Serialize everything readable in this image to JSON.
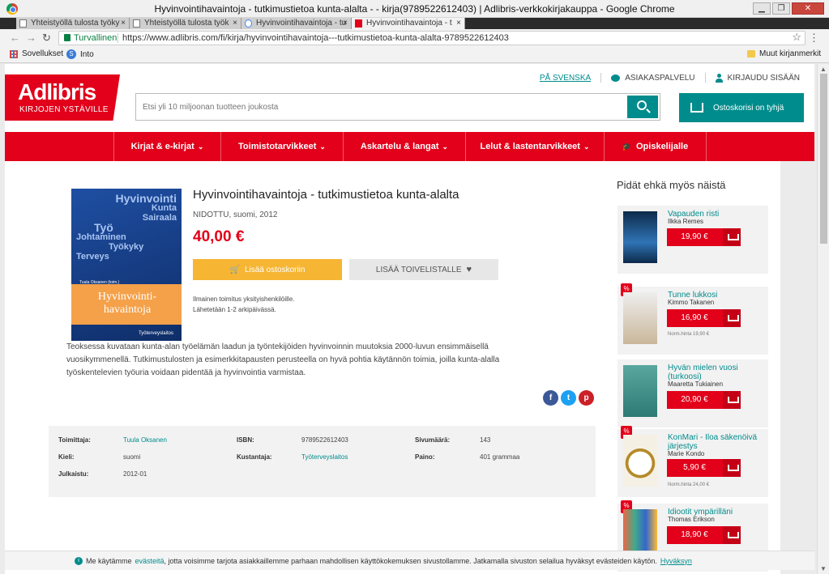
{
  "window": {
    "title": "Hyvinvointihavaintoja - tutkimustietoa kunta-alalta - - kirja(9789522612403) | Adlibris-verkkokirjakauppa - Google Chrome",
    "tabs": [
      {
        "label": "Yhteistyöllä tulosta työky"
      },
      {
        "label": "Yhteistyöllä tulosta työk"
      },
      {
        "label": "Hyvinvointihavaintoja - tu"
      },
      {
        "label": "Hyvinvointihavaintoja - t"
      }
    ]
  },
  "browser": {
    "secure_label": "Turvallinen",
    "url": "https://www.adlibris.com/fi/kirja/hyvinvointihavaintoja---tutkimustietoa-kunta-alalta-9789522612403",
    "bookmarks": {
      "apps": "Sovellukset",
      "into": "Into",
      "other": "Muut kirjanmerkit"
    }
  },
  "header": {
    "brand": "Adlibris",
    "tagline": "KIRJOJEN YSTÄVILLE",
    "lang_link": "PÅ SVENSKA",
    "customer_service": "ASIAKASPALVELU",
    "login": "KIRJAUDU SISÄÄN",
    "search_placeholder": "Etsi yli 10 miljoonan tuotteen joukosta",
    "cart_label": "Ostoskorisi on tyhjä"
  },
  "nav": [
    {
      "label": "Kirjat & e-kirjat"
    },
    {
      "label": "Toimistotarvikkeet"
    },
    {
      "label": "Askartelu & langat"
    },
    {
      "label": "Lelut & lastentarvikkeet"
    },
    {
      "label": "Opiskelijalle"
    }
  ],
  "product": {
    "title": "Hyvinvointihavaintoja - tutkimustietoa kunta-alalta",
    "meta": "NIDOTTU, suomi, 2012",
    "price": "40,00 €",
    "add_to_cart": "Lisää ostoskoriin",
    "wishlist": "LISÄÄ TOIVELISTALLE",
    "delivery_1": "Ilmainen toimitus yksityishenkilöille.",
    "delivery_2": "Lähetetään 1-2 arkipäivässä.",
    "description": "Teoksessa kuvataan kunta-alan työelämän laadun ja työntekijöiden hyvinvoinnin muutoksia 2000-luvun ensimmäisellä vuosikymmenellä. Tutkimustulosten ja esimerkkitapausten perusteella on hyvä pohtia käytännön toimia, joilla kunta-alalla työskentelevien työuria voidaan pidentää ja hyvinvointia varmistaa.",
    "cover": {
      "words": [
        "Hyvinvointi",
        "Kunta",
        "Sairaala",
        "Työ",
        "Johtaminen",
        "Työkyky",
        "Terveys"
      ],
      "title_1": "Hyvinvointi-",
      "title_2": "havaintoja",
      "author": "Tuula Oksanen (toim.)",
      "publisher": "Työterveyslaitos"
    }
  },
  "details": {
    "editor_label": "Toimittaja:",
    "editor": "Tuula Oksanen",
    "isbn_label": "ISBN:",
    "isbn": "9789522612403",
    "pages_label": "Sivumäärä:",
    "pages": "143",
    "lang_label": "Kieli:",
    "lang": "suomi",
    "publisher_label": "Kustantaja:",
    "publisher": "Työterveyslaitos",
    "weight_label": "Paino:",
    "weight": "401 grammaa",
    "published_label": "Julkaistu:",
    "published": "2012-01"
  },
  "sidebar": {
    "title": "Pidät ehkä myös näistä",
    "items": [
      {
        "title": "Vapauden risti",
        "author": "Ilkka Remes",
        "price": "19,90 €",
        "norm": ""
      },
      {
        "title": "Tunne lukkosi",
        "author": "Kimmo Takanen",
        "price": "16,90 €",
        "norm": "Norm.hinta 19,90 €"
      },
      {
        "title": "Hyvän mielen vuosi (turkoosi)",
        "author": "Maaretta Tukiainen",
        "price": "20,90 €",
        "norm": ""
      },
      {
        "title": "KonMari - Iloa säkenöivä järjestys",
        "author": "Marie Kondo",
        "price": "5,90 €",
        "norm": "Norm.hinta 24,00 €"
      },
      {
        "title": "Idiootit ympärilläni",
        "author": "Thomas Erikson",
        "price": "18,90 €",
        "norm": ""
      }
    ],
    "discount_badge": "%"
  },
  "cookie": {
    "text_1": "Me käytämme",
    "link": "evästeitä",
    "text_2": ", jotta voisimme tarjota asiakkaillemme parhaan mahdollisen käyttökokemuksen sivustollamme. Jatkamalla sivuston selailua hyväksyt evästeiden käytön.",
    "accept": "Hyväksyn"
  },
  "colors": {
    "brand_red": "#e2001a",
    "teal": "#008c8c",
    "orange": "#f6b532"
  }
}
